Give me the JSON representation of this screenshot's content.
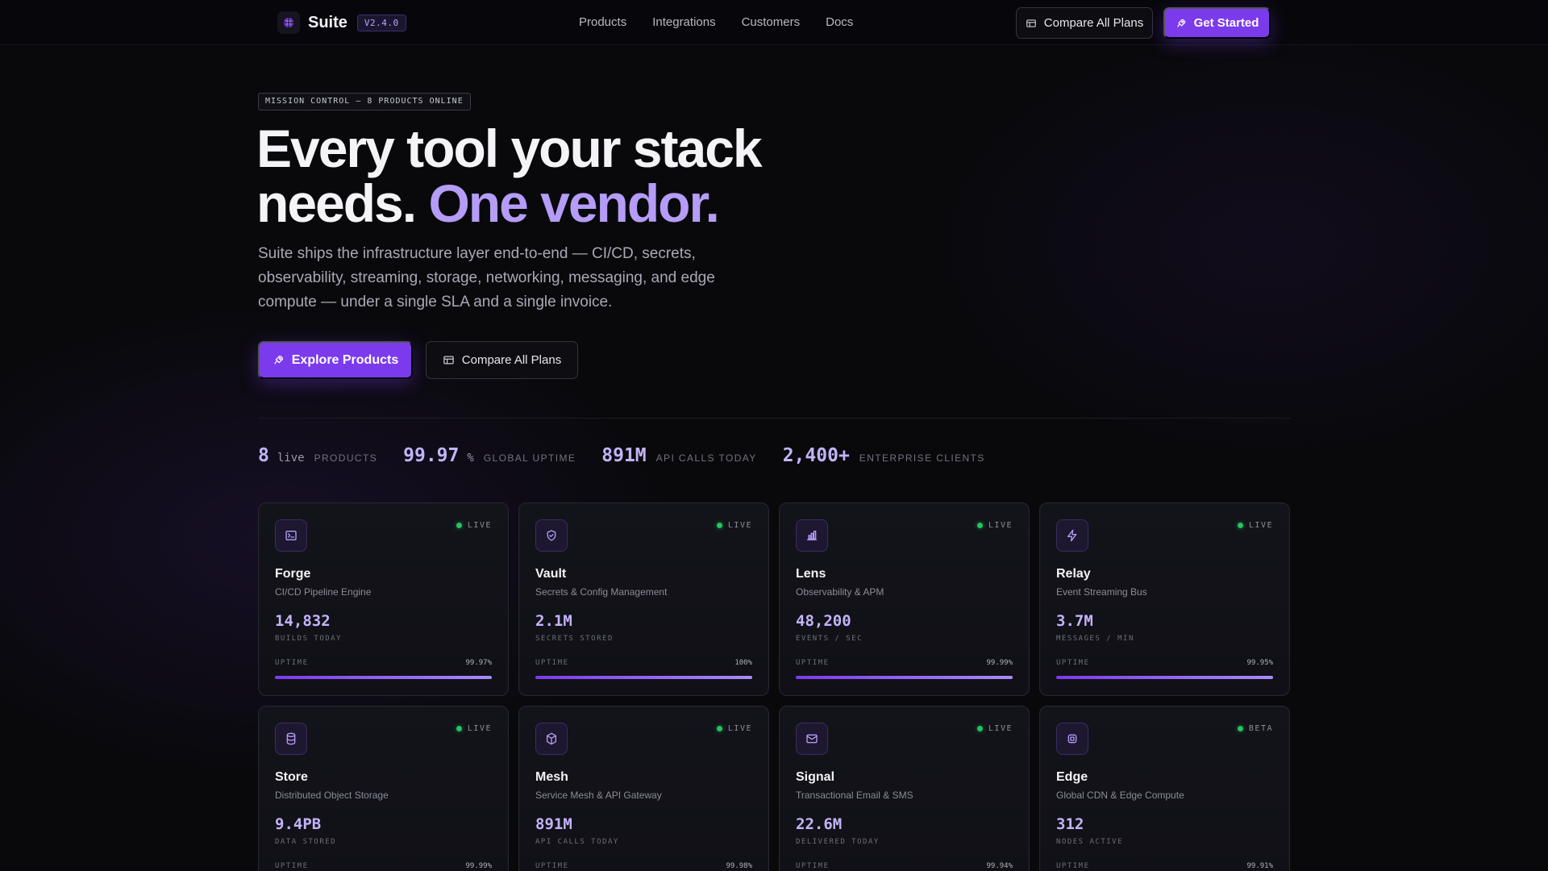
{
  "nav": {
    "brand": "Suite",
    "version": "V2.4.0",
    "links": [
      "Products",
      "Integrations",
      "Customers",
      "Docs"
    ],
    "compare_label": "Compare All Plans",
    "start_label": "Get Started"
  },
  "hero": {
    "tag": "MISSION CONTROL — 8 PRODUCTS ONLINE",
    "headline_line1": "Every tool your stack",
    "headline_line2_plain": "needs.",
    "headline_line2_accent": "One vendor.",
    "lede": "Suite ships the infrastructure layer end-to-end — CI/CD, secrets, observability, streaming, storage, networking, messaging, and edge compute — under a single SLA and a single invoice.",
    "primary_cta": "Explore Products",
    "secondary_cta": "Compare All Plans"
  },
  "stats": [
    {
      "value": "8",
      "unit": "live",
      "label": "PRODUCTS"
    },
    {
      "value": "99.97",
      "unit": "%",
      "label": "GLOBAL UPTIME"
    },
    {
      "value": "891M",
      "unit": "",
      "label": "API CALLS TODAY"
    },
    {
      "value": "2,400+",
      "unit": "",
      "label": "ENTERPRISE CLIENTS"
    }
  ],
  "products": [
    {
      "icon": "terminal-icon",
      "status": "LIVE",
      "name": "Forge",
      "desc": "CI/CD Pipeline Engine",
      "metric": "14,832",
      "metric_label": "BUILDS TODAY",
      "uptime_label": "UPTIME",
      "uptime": "99.97%",
      "uptime_pct": 99.97
    },
    {
      "icon": "shield-icon",
      "status": "LIVE",
      "name": "Vault",
      "desc": "Secrets & Config Management",
      "metric": "2.1M",
      "metric_label": "SECRETS STORED",
      "uptime_label": "UPTIME",
      "uptime": "100%",
      "uptime_pct": 100
    },
    {
      "icon": "bar-chart-icon",
      "status": "LIVE",
      "name": "Lens",
      "desc": "Observability & APM",
      "metric": "48,200",
      "metric_label": "EVENTS / SEC",
      "uptime_label": "UPTIME",
      "uptime": "99.99%",
      "uptime_pct": 99.99
    },
    {
      "icon": "lightning-icon",
      "status": "LIVE",
      "name": "Relay",
      "desc": "Event Streaming Bus",
      "metric": "3.7M",
      "metric_label": "MESSAGES / MIN",
      "uptime_label": "UPTIME",
      "uptime": "99.95%",
      "uptime_pct": 99.95
    },
    {
      "icon": "database-icon",
      "status": "LIVE",
      "name": "Store",
      "desc": "Distributed Object Storage",
      "metric": "9.4PB",
      "metric_label": "DATA STORED",
      "uptime_label": "UPTIME",
      "uptime": "99.99%",
      "uptime_pct": 99.99
    },
    {
      "icon": "cube-icon",
      "status": "LIVE",
      "name": "Mesh",
      "desc": "Service Mesh & API Gateway",
      "metric": "891M",
      "metric_label": "API CALLS TODAY",
      "uptime_label": "UPTIME",
      "uptime": "99.98%",
      "uptime_pct": 99.98
    },
    {
      "icon": "mail-icon",
      "status": "LIVE",
      "name": "Signal",
      "desc": "Transactional Email & SMS",
      "metric": "22.6M",
      "metric_label": "DELIVERED TODAY",
      "uptime_label": "UPTIME",
      "uptime": "99.94%",
      "uptime_pct": 99.94
    },
    {
      "icon": "chip-icon",
      "status": "BETA",
      "name": "Edge",
      "desc": "Global CDN & Edge Compute",
      "metric": "312",
      "metric_label": "NODES ACTIVE",
      "uptime_label": "UPTIME",
      "uptime": "99.91%",
      "uptime_pct": 99.91
    }
  ],
  "colors": {
    "accent": "#7c3aed",
    "accent_text": "#b59cf7",
    "status_live": "#22c55e"
  }
}
